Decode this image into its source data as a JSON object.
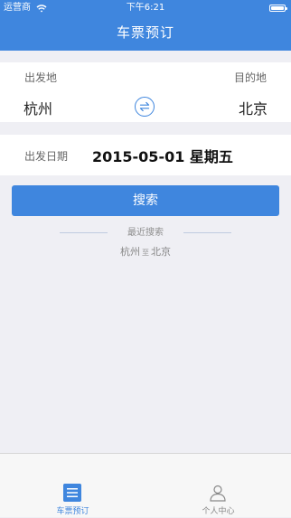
{
  "status_bar": {
    "carrier": "运营商",
    "time": "下午6:21"
  },
  "nav": {
    "title": "车票预订"
  },
  "route": {
    "from_label": "出发地",
    "to_label": "目的地",
    "from_city": "杭州",
    "to_city": "北京"
  },
  "date": {
    "label": "出发日期",
    "value": "2015-05-01 星期五"
  },
  "actions": {
    "search_label": "搜索"
  },
  "recent": {
    "title": "最近搜索",
    "item": {
      "from": "杭州",
      "to_word": "至",
      "to": "北京"
    }
  },
  "tabbar": {
    "tabs": [
      {
        "label": "车票预订",
        "active": true,
        "icon": "list-icon"
      },
      {
        "label": "个人中心",
        "active": false,
        "icon": "person-icon"
      }
    ]
  },
  "colors": {
    "accent": "#3f86de",
    "background": "#efeff4"
  }
}
